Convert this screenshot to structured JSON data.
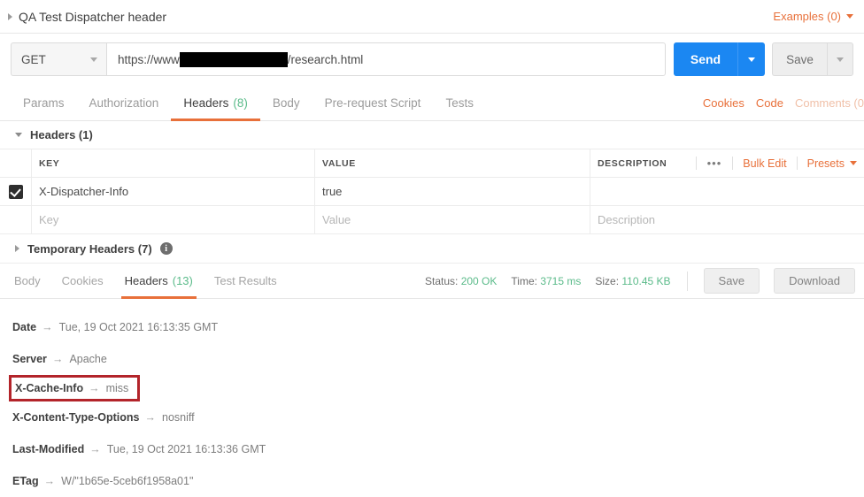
{
  "request_name": {
    "title": "QA Test Dispatcher header",
    "collapse_icon": "triangle-right-icon",
    "examples_label": "Examples (0)",
    "examples_caret": "caret-down-icon"
  },
  "url_bar": {
    "method": "GET",
    "method_caret": "caret-down-icon",
    "url_prefix": "https://www",
    "url_redacted": "",
    "url_suffix": "/research.html",
    "send_label": "Send",
    "send_caret": "caret-down-icon",
    "save_label": "Save",
    "save_caret": "caret-down-icon"
  },
  "request_tabs": {
    "items": [
      {
        "label": "Params",
        "count": "",
        "active": false
      },
      {
        "label": "Authorization",
        "count": "",
        "active": false
      },
      {
        "label": "Headers",
        "count": "(8)",
        "active": true
      },
      {
        "label": "Body",
        "count": "",
        "active": false
      },
      {
        "label": "Pre-request Script",
        "count": "",
        "active": false
      },
      {
        "label": "Tests",
        "count": "",
        "active": false
      }
    ],
    "cookies_label": "Cookies",
    "code_label": "Code",
    "comments_label": "Comments (0"
  },
  "headers_section": {
    "title": "Headers (1)",
    "expand_icon": "triangle-down-icon",
    "columns": {
      "key": "KEY",
      "value": "VALUE",
      "description": "DESCRIPTION"
    },
    "tools": {
      "more_icon": "•••",
      "bulk_edit": "Bulk Edit",
      "presets": "Presets",
      "presets_caret": "caret-down-icon"
    },
    "rows": [
      {
        "checked": true,
        "key": "X-Dispatcher-Info",
        "value": "true",
        "description": ""
      }
    ],
    "placeholder_row": {
      "key": "Key",
      "value": "Value",
      "description": "Description"
    }
  },
  "temporary_headers": {
    "label": "Temporary Headers (7)",
    "collapse_icon": "triangle-right-icon",
    "info_icon": "info-icon"
  },
  "response": {
    "tabs": [
      {
        "label": "Body",
        "count": "",
        "active": false
      },
      {
        "label": "Cookies",
        "count": "",
        "active": false
      },
      {
        "label": "Headers",
        "count": "(13)",
        "active": true
      },
      {
        "label": "Test Results",
        "count": "",
        "active": false
      }
    ],
    "status_label": "Status:",
    "status_value": "200 OK",
    "time_label": "Time:",
    "time_value": "3715 ms",
    "size_label": "Size:",
    "size_value": "110.45 KB",
    "save_label": "Save",
    "download_label": "Download",
    "headers": [
      {
        "name": "Date",
        "value": "Tue, 19 Oct 2021 16:13:35 GMT",
        "highlighted": false
      },
      {
        "name": "Server",
        "value": "Apache",
        "highlighted": false
      },
      {
        "name": "X-Cache-Info",
        "value": "miss",
        "highlighted": true
      },
      {
        "name": "X-Content-Type-Options",
        "value": "nosniff",
        "highlighted": false
      },
      {
        "name": "Last-Modified",
        "value": "Tue, 19 Oct 2021 16:13:36 GMT",
        "highlighted": false
      },
      {
        "name": "ETag",
        "value": "W/\"1b65e-5ceb6f1958a01\"",
        "highlighted": false
      }
    ],
    "arrow_glyph": "→"
  },
  "colors": {
    "accent_orange": "#e8703a",
    "send_blue": "#1b87f2",
    "status_green": "#5bbb8a",
    "highlight_red": "#b3242a"
  }
}
